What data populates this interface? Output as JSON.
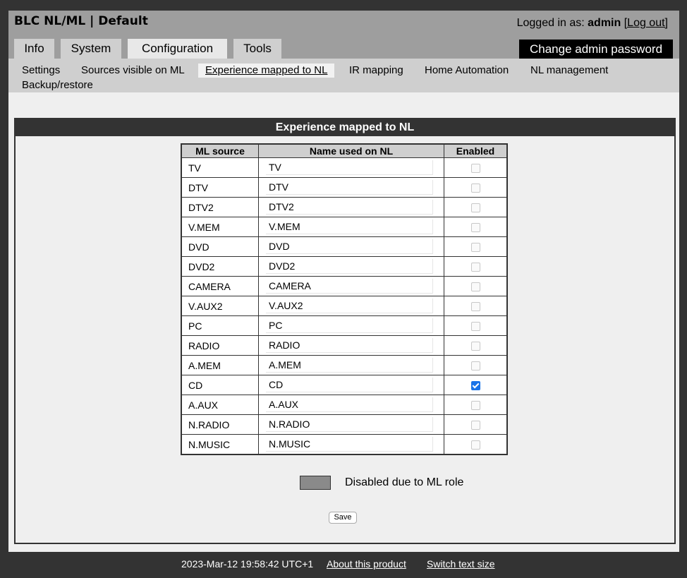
{
  "app": {
    "title": "BLC NL/ML | Default"
  },
  "login": {
    "prefix": "Logged in as: ",
    "user": "admin",
    "logout_label": "[Log out]"
  },
  "tabs": [
    {
      "label": "Info"
    },
    {
      "label": "System"
    },
    {
      "label": "Configuration"
    },
    {
      "label": "Tools"
    }
  ],
  "change_password_label": "Change admin password",
  "subnav": [
    {
      "label": "Settings"
    },
    {
      "label": "Sources visible on ML"
    },
    {
      "label": "Experience mapped to NL"
    },
    {
      "label": "IR mapping"
    },
    {
      "label": "Home Automation"
    },
    {
      "label": "NL management"
    },
    {
      "label": "Backup/restore"
    }
  ],
  "panel": {
    "title": "Experience mapped to NL",
    "columns": [
      "ML source",
      "Name used on NL",
      "Enabled"
    ],
    "rows": [
      {
        "source": "TV",
        "name": "TV",
        "enabled": false
      },
      {
        "source": "DTV",
        "name": "DTV",
        "enabled": false
      },
      {
        "source": "DTV2",
        "name": "DTV2",
        "enabled": false
      },
      {
        "source": "V.MEM",
        "name": "V.MEM",
        "enabled": false
      },
      {
        "source": "DVD",
        "name": "DVD",
        "enabled": false
      },
      {
        "source": "DVD2",
        "name": "DVD2",
        "enabled": false
      },
      {
        "source": "CAMERA",
        "name": "CAMERA",
        "enabled": false
      },
      {
        "source": "V.AUX2",
        "name": "V.AUX2",
        "enabled": false
      },
      {
        "source": "PC",
        "name": "PC",
        "enabled": false
      },
      {
        "source": "RADIO",
        "name": "RADIO",
        "enabled": false
      },
      {
        "source": "A.MEM",
        "name": "A.MEM",
        "enabled": false
      },
      {
        "source": "CD",
        "name": "CD",
        "enabled": true
      },
      {
        "source": "A.AUX",
        "name": "A.AUX",
        "enabled": false
      },
      {
        "source": "N.RADIO",
        "name": "N.RADIO",
        "enabled": false
      },
      {
        "source": "N.MUSIC",
        "name": "N.MUSIC",
        "enabled": false
      }
    ],
    "legend_label": "Disabled due to ML role",
    "save_label": "Save"
  },
  "colors": {
    "background": "#333333",
    "header": "#9e9e9e",
    "tab": "#cfcfcf",
    "checkbox_checked": "#1a73e8",
    "legend_swatch": "#8a8a8a"
  },
  "footer": {
    "timestamp": "2023-Mar-12 19:58:42 UTC+1",
    "about_label": "About this product",
    "switch_label": "Switch text size"
  }
}
